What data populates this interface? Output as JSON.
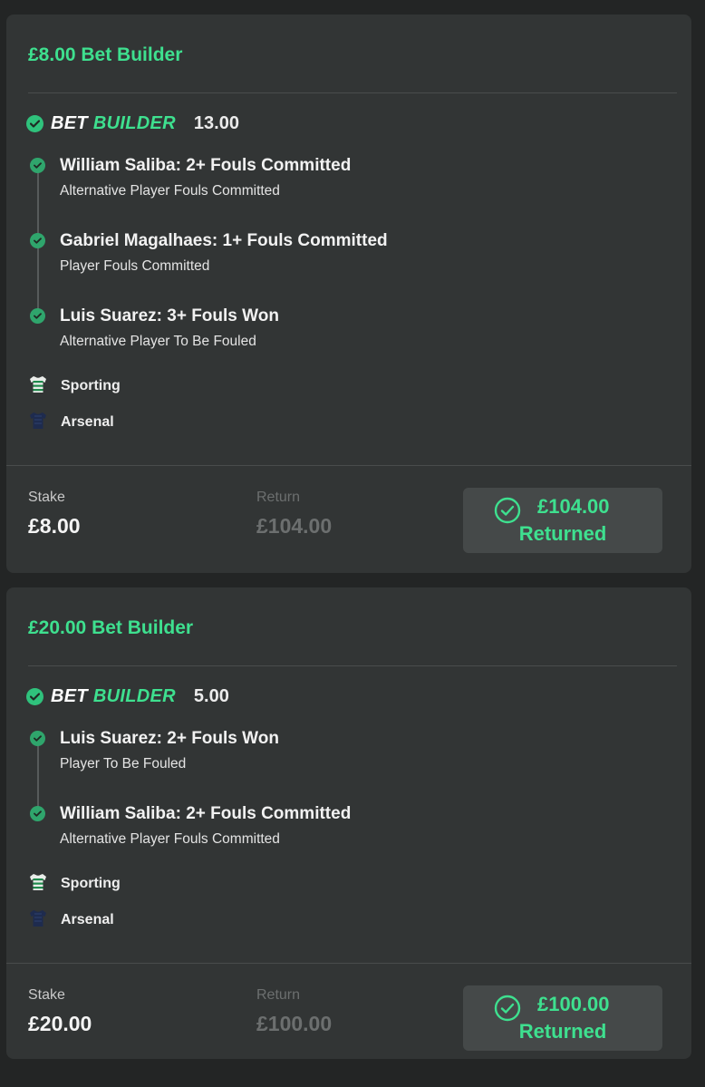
{
  "colors": {
    "accent": "#3ee08f",
    "card": "#323535",
    "background": "#232525",
    "button": "#454949"
  },
  "bets": [
    {
      "title": "£8.00 Bet Builder",
      "bet_builder": {
        "word1": "BET",
        "word2": "BUILDER",
        "odds": "13.00"
      },
      "legs": [
        {
          "title": "William Saliba: 2+ Fouls Committed",
          "subtitle": "Alternative Player Fouls Committed"
        },
        {
          "title": "Gabriel Magalhaes: 1+ Fouls Committed",
          "subtitle": "Player Fouls Committed"
        },
        {
          "title": "Luis Suarez: 3+ Fouls Won",
          "subtitle": "Alternative Player To Be Fouled"
        }
      ],
      "teams": [
        {
          "name": "Sporting",
          "icon": "striped-shirt-icon"
        },
        {
          "name": "Arsenal",
          "icon": "navy-shirt-icon"
        }
      ],
      "stake_label": "Stake",
      "stake_value": "£8.00",
      "return_label": "Return",
      "return_value": "£104.00",
      "returned_amount": "£104.00",
      "returned_label": "Returned"
    },
    {
      "title": "£20.00 Bet Builder",
      "bet_builder": {
        "word1": "BET",
        "word2": "BUILDER",
        "odds": "5.00"
      },
      "legs": [
        {
          "title": "Luis Suarez: 2+ Fouls Won",
          "subtitle": "Player To Be Fouled"
        },
        {
          "title": "William Saliba: 2+ Fouls Committed",
          "subtitle": "Alternative Player Fouls Committed"
        }
      ],
      "teams": [
        {
          "name": "Sporting",
          "icon": "striped-shirt-icon"
        },
        {
          "name": "Arsenal",
          "icon": "navy-shirt-icon"
        }
      ],
      "stake_label": "Stake",
      "stake_value": "£20.00",
      "return_label": "Return",
      "return_value": "£100.00",
      "returned_amount": "£100.00",
      "returned_label": "Returned"
    }
  ]
}
